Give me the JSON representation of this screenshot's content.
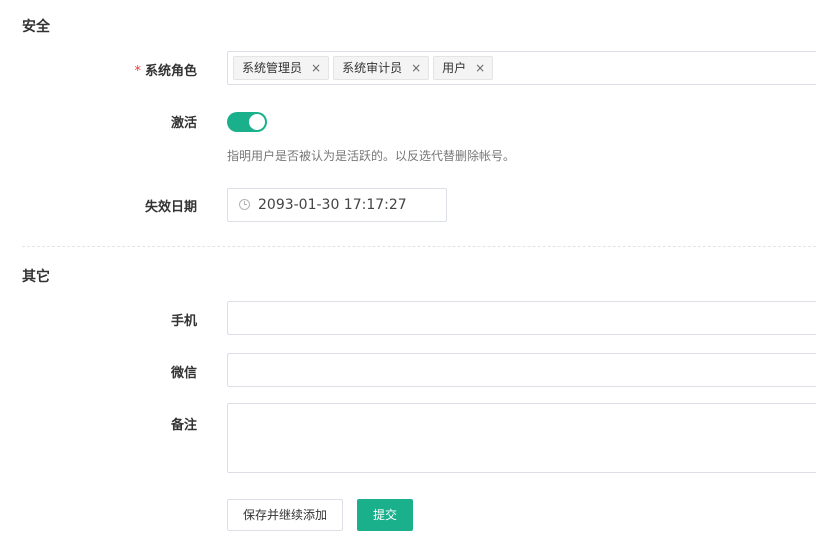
{
  "security": {
    "title": "安全",
    "roles_label": "系统角色",
    "required_mark": "*",
    "roles": [
      {
        "label": "系统管理员",
        "remove": "×"
      },
      {
        "label": "系统审计员",
        "remove": "×"
      },
      {
        "label": "用户",
        "remove": "×"
      }
    ],
    "active_label": "激活",
    "active_on": true,
    "active_help": "指明用户是否被认为是活跃的。以反选代替删除帐号。",
    "expire_label": "失效日期",
    "expire_value": "2093-01-30 17:17:27"
  },
  "other": {
    "title": "其它",
    "phone_label": "手机",
    "phone_value": "",
    "wechat_label": "微信",
    "wechat_value": "",
    "note_label": "备注",
    "note_value": ""
  },
  "actions": {
    "save_continue": "保存并继续添加",
    "submit": "提交"
  },
  "colors": {
    "primary": "#1bb08c",
    "required": "#e4393c"
  },
  "icons": {
    "expire": "clock-icon",
    "tag_remove": "close-icon"
  }
}
